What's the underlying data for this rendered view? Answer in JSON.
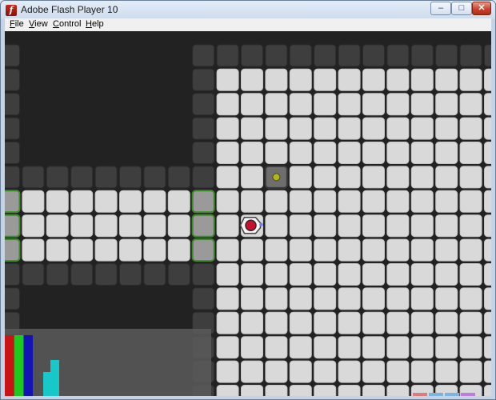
{
  "window": {
    "title": "Adobe Flash Player 10",
    "minimize_glyph": "–",
    "maximize_glyph": "□",
    "close_glyph": "✕",
    "app_icon_glyph": "f"
  },
  "menu": {
    "file": "File",
    "view": "View",
    "control": "Control",
    "help": "Help"
  },
  "game": {
    "colors": {
      "background": "#222222",
      "wall_tile": "#3e3e3e",
      "floor_tile": "#d9d9d9",
      "door_outline": "#3c8c28",
      "player_core": "#c8102e",
      "pickup_dot": "#b4b41e",
      "hud_panel": "#5a5a5a"
    },
    "entities": {
      "player": "player-robot",
      "pickup": "pickup-crate"
    },
    "hud": {
      "bars": [
        {
          "name": "red-bar",
          "color": "#c81414",
          "level": 1.0
        },
        {
          "name": "green-bar",
          "color": "#1ec81e",
          "level": 1.0
        },
        {
          "name": "blue-bar",
          "color": "#1414b4",
          "level": 1.0
        },
        {
          "name": "cyan-bar-1",
          "color": "#16c8c8",
          "level": 0.55
        },
        {
          "name": "cyan-bar-2",
          "color": "#16c8c8",
          "level": 0.6
        }
      ]
    }
  }
}
